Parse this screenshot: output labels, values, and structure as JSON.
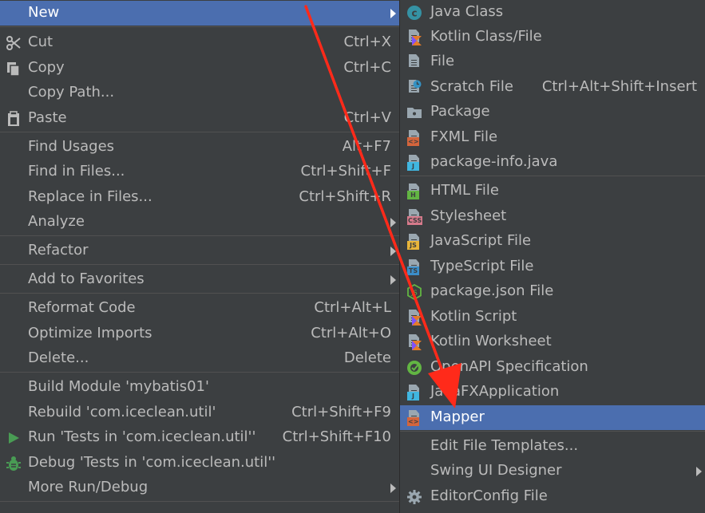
{
  "left_menu": {
    "new": {
      "label": "New"
    },
    "cut": {
      "label": "Cut",
      "shortcut": "Ctrl+X"
    },
    "copy": {
      "label": "Copy",
      "shortcut": "Ctrl+C"
    },
    "copy_path": {
      "label": "Copy Path..."
    },
    "paste": {
      "label": "Paste",
      "shortcut": "Ctrl+V"
    },
    "find_usages": {
      "label": "Find Usages",
      "shortcut": "Alt+F7"
    },
    "find_in_files": {
      "label": "Find in Files...",
      "shortcut": "Ctrl+Shift+F"
    },
    "replace_in_files": {
      "label": "Replace in Files...",
      "shortcut": "Ctrl+Shift+R"
    },
    "analyze": {
      "label": "Analyze"
    },
    "refactor": {
      "label": "Refactor"
    },
    "add_to_favorites": {
      "label": "Add to Favorites"
    },
    "reformat_code": {
      "label": "Reformat Code",
      "shortcut": "Ctrl+Alt+L"
    },
    "optimize_imports": {
      "label": "Optimize Imports",
      "shortcut": "Ctrl+Alt+O"
    },
    "delete": {
      "label": "Delete...",
      "shortcut": "Delete"
    },
    "build_module": {
      "label": "Build Module 'mybatis01'"
    },
    "rebuild": {
      "label": "Rebuild 'com.iceclean.util'",
      "shortcut": "Ctrl+Shift+F9"
    },
    "run": {
      "label": "Run 'Tests in 'com.iceclean.util''",
      "shortcut": "Ctrl+Shift+F10"
    },
    "debug": {
      "label": "Debug 'Tests in 'com.iceclean.util''"
    },
    "more_run_debug": {
      "label": "More Run/Debug"
    }
  },
  "right_menu": {
    "java_class": {
      "label": "Java Class"
    },
    "kotlin_class": {
      "label": "Kotlin Class/File"
    },
    "file": {
      "label": "File"
    },
    "scratch_file": {
      "label": "Scratch File",
      "shortcut": "Ctrl+Alt+Shift+Insert"
    },
    "package": {
      "label": "Package"
    },
    "fxml_file": {
      "label": "FXML File"
    },
    "package_info": {
      "label": "package-info.java"
    },
    "html_file": {
      "label": "HTML File"
    },
    "stylesheet": {
      "label": "Stylesheet"
    },
    "javascript_file": {
      "label": "JavaScript File"
    },
    "typescript_file": {
      "label": "TypeScript File"
    },
    "package_json": {
      "label": "package.json File"
    },
    "kotlin_script": {
      "label": "Kotlin Script"
    },
    "kotlin_worksheet": {
      "label": "Kotlin Worksheet"
    },
    "openapi": {
      "label": "OpenAPI Specification"
    },
    "javafx_app": {
      "label": "JavaFXApplication"
    },
    "mapper": {
      "label": "Mapper"
    },
    "edit_templates": {
      "label": "Edit File Templates..."
    },
    "swing_designer": {
      "label": "Swing UI Designer"
    },
    "editorconfig": {
      "label": "EditorConfig File"
    }
  },
  "icon_tags": {
    "fxml": "<>",
    "java": "J",
    "html": "H",
    "css": "CSS",
    "js": "JS",
    "ts": "TS",
    "mapper": "<>"
  },
  "colors": {
    "menu_bg": "#3c3f41",
    "selection": "#4b6eaf",
    "text": "#bbbbbb",
    "annotation_arrow": "#ff2a1a"
  }
}
